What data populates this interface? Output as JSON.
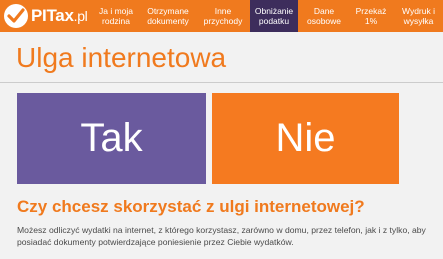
{
  "brand": {
    "name": "PITax",
    "suffix": ".pl"
  },
  "nav": [
    {
      "label": "Ja i moja rodzina",
      "active": false
    },
    {
      "label": "Otrzymane dokumenty",
      "active": false
    },
    {
      "label": "Inne przychody",
      "active": false
    },
    {
      "label": "Obniżanie podatku",
      "active": true
    },
    {
      "label": "Dane osobowe",
      "active": false
    },
    {
      "label": "Przekaż 1%",
      "active": false
    },
    {
      "label": "Wydruk i wysyłka",
      "active": false
    }
  ],
  "page": {
    "title": "Ulga internetowa",
    "yes_label": "Tak",
    "no_label": "Nie",
    "question": "Czy chcesz skorzystać z ulgi internetowej?",
    "description": "Możesz odliczyć wydatki na internet, z którego korzystasz, zarówno w domu, przez telefon, jak i z tylko, aby posiadać dokumenty potwierdzające poniesienie przez Ciebie wydatków."
  },
  "colors": {
    "accent": "#f07a1e",
    "active_nav": "#3d2d5c",
    "yes": "#6a5a9e",
    "no": "#f57a20"
  },
  "icons": {
    "logo": "checkmark-icon"
  }
}
